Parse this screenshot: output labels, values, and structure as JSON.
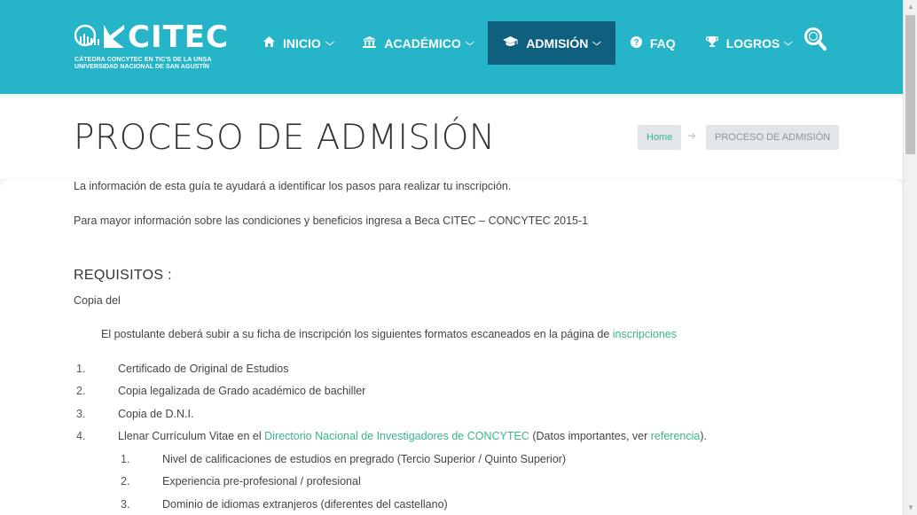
{
  "header": {
    "logo_text": "CITEC",
    "logo_sub1": "CÁTEDRA CONCYTEC EN TIC'S DE LA UNSA",
    "logo_sub2": "UNIVERSIDAD NACIONAL DE SAN AGUSTÍN",
    "nav": [
      {
        "label": "INICIO",
        "icon": "home-icon",
        "dropdown": true
      },
      {
        "label": "ACADÉMICO",
        "icon": "bank-icon",
        "dropdown": true
      },
      {
        "label": "ADMISIÓN",
        "icon": "graduation-cap-icon",
        "dropdown": true,
        "active": true
      },
      {
        "label": "FAQ",
        "icon": "question-circle-icon",
        "dropdown": false
      },
      {
        "label": "LOGROS",
        "icon": "trophy-icon",
        "dropdown": true
      }
    ],
    "search_icon": "search-icon"
  },
  "title_bar": {
    "page_title": "PROCESO DE ADMISIÓN",
    "breadcrumb": {
      "home": "Home",
      "current": "PROCESO DE ADMISIÓN"
    }
  },
  "content": {
    "intro": "La información de esta guía te ayudará a identificar los pasos para realizar tu inscripción.",
    "more_info": "Para mayor información sobre las condiciones y beneficios ingresa a Beca CITEC – CONCYTEC 2015-1",
    "requisitos_heading": "REQUISITOS :",
    "copia_del": "Copia del",
    "upload_note": {
      "text": "El postulante deberá subir a su ficha de inscripción los siguientes formatos escaneados en  la página de ",
      "link": "inscripciones"
    },
    "list": [
      {
        "num": "1.",
        "text": "Certificado de Original de Estudios"
      },
      {
        "num": "2.",
        "text": "Copia legalizada de Grado académico de bachiller"
      },
      {
        "num": "3.",
        "text": "Copia de D.N.I."
      },
      {
        "num": "4.",
        "text_before": "Llenar Currículum Vitae en el ",
        "link1": "Directorio Nacional de Investigadores de CONCYTEC",
        "text_mid": " (Datos importantes, ver ",
        "link2": "referencia",
        "text_after": ")."
      }
    ],
    "sublist": [
      {
        "num": "1.",
        "text": "Nivel de calificaciones de estudios en pregrado  (Tercio Superior / Quinto Superior)"
      },
      {
        "num": "2.",
        "text": "Experiencia pre-profesional / profesional"
      },
      {
        "num": "3.",
        "text": "Dominio de idiomas extranjeros (diferentes del castellano)"
      }
    ]
  },
  "colors": {
    "header_bg": "#26b5c8",
    "active_nav_bg": "#0f5f7f",
    "link": "#3bb58e"
  }
}
